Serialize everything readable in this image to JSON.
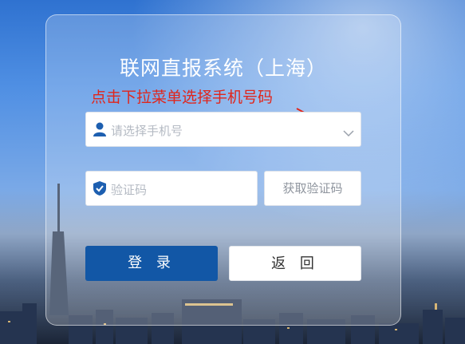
{
  "title": "联网直报系统（上海）",
  "annotation": {
    "text": "点击下拉菜单选择手机号码",
    "color": "#e1251b"
  },
  "phone_select": {
    "placeholder": "请选择手机号",
    "icon": "user-icon",
    "dropdown_icon": "chevron-down-icon"
  },
  "code_field": {
    "placeholder": "验证码",
    "icon": "shield-check-icon"
  },
  "buttons": {
    "get_code": "获取验证码",
    "login": "登 录",
    "back": "返 回"
  },
  "colors": {
    "primary": "#1257a6",
    "icon": "#1d5fb0",
    "annotation": "#e1251b"
  }
}
